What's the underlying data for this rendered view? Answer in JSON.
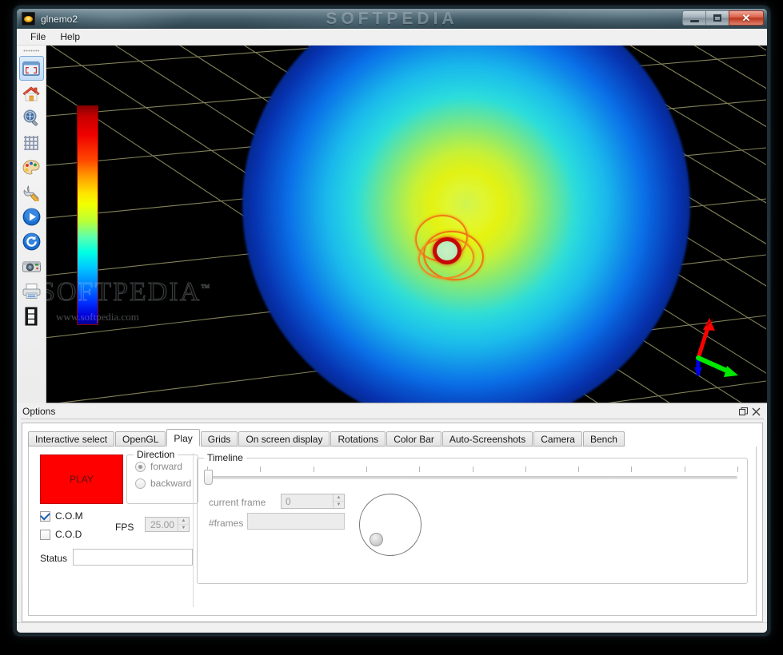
{
  "window": {
    "title": "glnemo2",
    "watermark_banner": "SOFTPEDIA",
    "controls": {
      "minimize": "minimize",
      "maximize": "maximize",
      "close": "close"
    }
  },
  "menubar": {
    "items": [
      {
        "label": "File"
      },
      {
        "label": "Help"
      }
    ]
  },
  "toolbar": {
    "items": [
      {
        "name": "fullscreen-icon",
        "tooltip": "Full screen"
      },
      {
        "name": "home-icon",
        "tooltip": "Reset view"
      },
      {
        "name": "zoom-icon",
        "tooltip": "Zoom"
      },
      {
        "name": "grid-icon",
        "tooltip": "Grids"
      },
      {
        "name": "palette-icon",
        "tooltip": "Colors"
      },
      {
        "name": "wrench-icon",
        "tooltip": "Options"
      },
      {
        "name": "play-icon",
        "tooltip": "Play"
      },
      {
        "name": "reload-icon",
        "tooltip": "Reload"
      },
      {
        "name": "camera-icon",
        "tooltip": "Screenshot"
      },
      {
        "name": "print-icon",
        "tooltip": "Print"
      },
      {
        "name": "movie-icon",
        "tooltip": "Movie"
      }
    ]
  },
  "glview": {
    "watermark": "SOFTPEDIA",
    "watermark_tm": "™",
    "watermark_url": "www.softpedia.com",
    "colorbar": {
      "name": "color-bar",
      "stops": [
        "#8a0000",
        "#ff0000",
        "#ff9a00",
        "#ffe400",
        "#b6ff3a",
        "#00ffe4",
        "#00c8ff",
        "#0030ff",
        "#000090"
      ]
    },
    "axis_gizmo": {
      "x_color": "#ff0000",
      "y_color": "#00e000",
      "z_color": "#0000ff"
    },
    "grid_color": "#9a9a6a",
    "background": "#000000"
  },
  "dock": {
    "title": "Options",
    "float_label": "❐",
    "close_label": "✕"
  },
  "tabs": [
    {
      "label": "Interactive select",
      "active": false
    },
    {
      "label": "OpenGL",
      "active": false
    },
    {
      "label": "Play",
      "active": true
    },
    {
      "label": "Grids",
      "active": false
    },
    {
      "label": "On screen display",
      "active": false
    },
    {
      "label": "Rotations",
      "active": false
    },
    {
      "label": "Color Bar",
      "active": false
    },
    {
      "label": "Auto-Screenshots",
      "active": false
    },
    {
      "label": "Camera",
      "active": false
    },
    {
      "label": "Bench",
      "active": false
    }
  ],
  "play": {
    "play_button": "PLAY",
    "play_button_color": "#ff0000",
    "direction": {
      "title": "Direction",
      "forward": "forward",
      "backward": "backward",
      "selected": "forward"
    },
    "com": {
      "label": "C.O.M",
      "checked": true
    },
    "cod": {
      "label": "C.O.D",
      "checked": false
    },
    "fps": {
      "label": "FPS",
      "value": "25.00"
    },
    "status": {
      "label": "Status",
      "value": ""
    }
  },
  "timeline": {
    "title": "Timeline",
    "slider_value": 0,
    "tick_count": 11,
    "current_frame": {
      "label": "current frame",
      "value": "0"
    },
    "num_frames": {
      "label": "#frames",
      "value": ""
    },
    "dial": {
      "name": "timeline-dial",
      "angle_deg": 215
    }
  }
}
